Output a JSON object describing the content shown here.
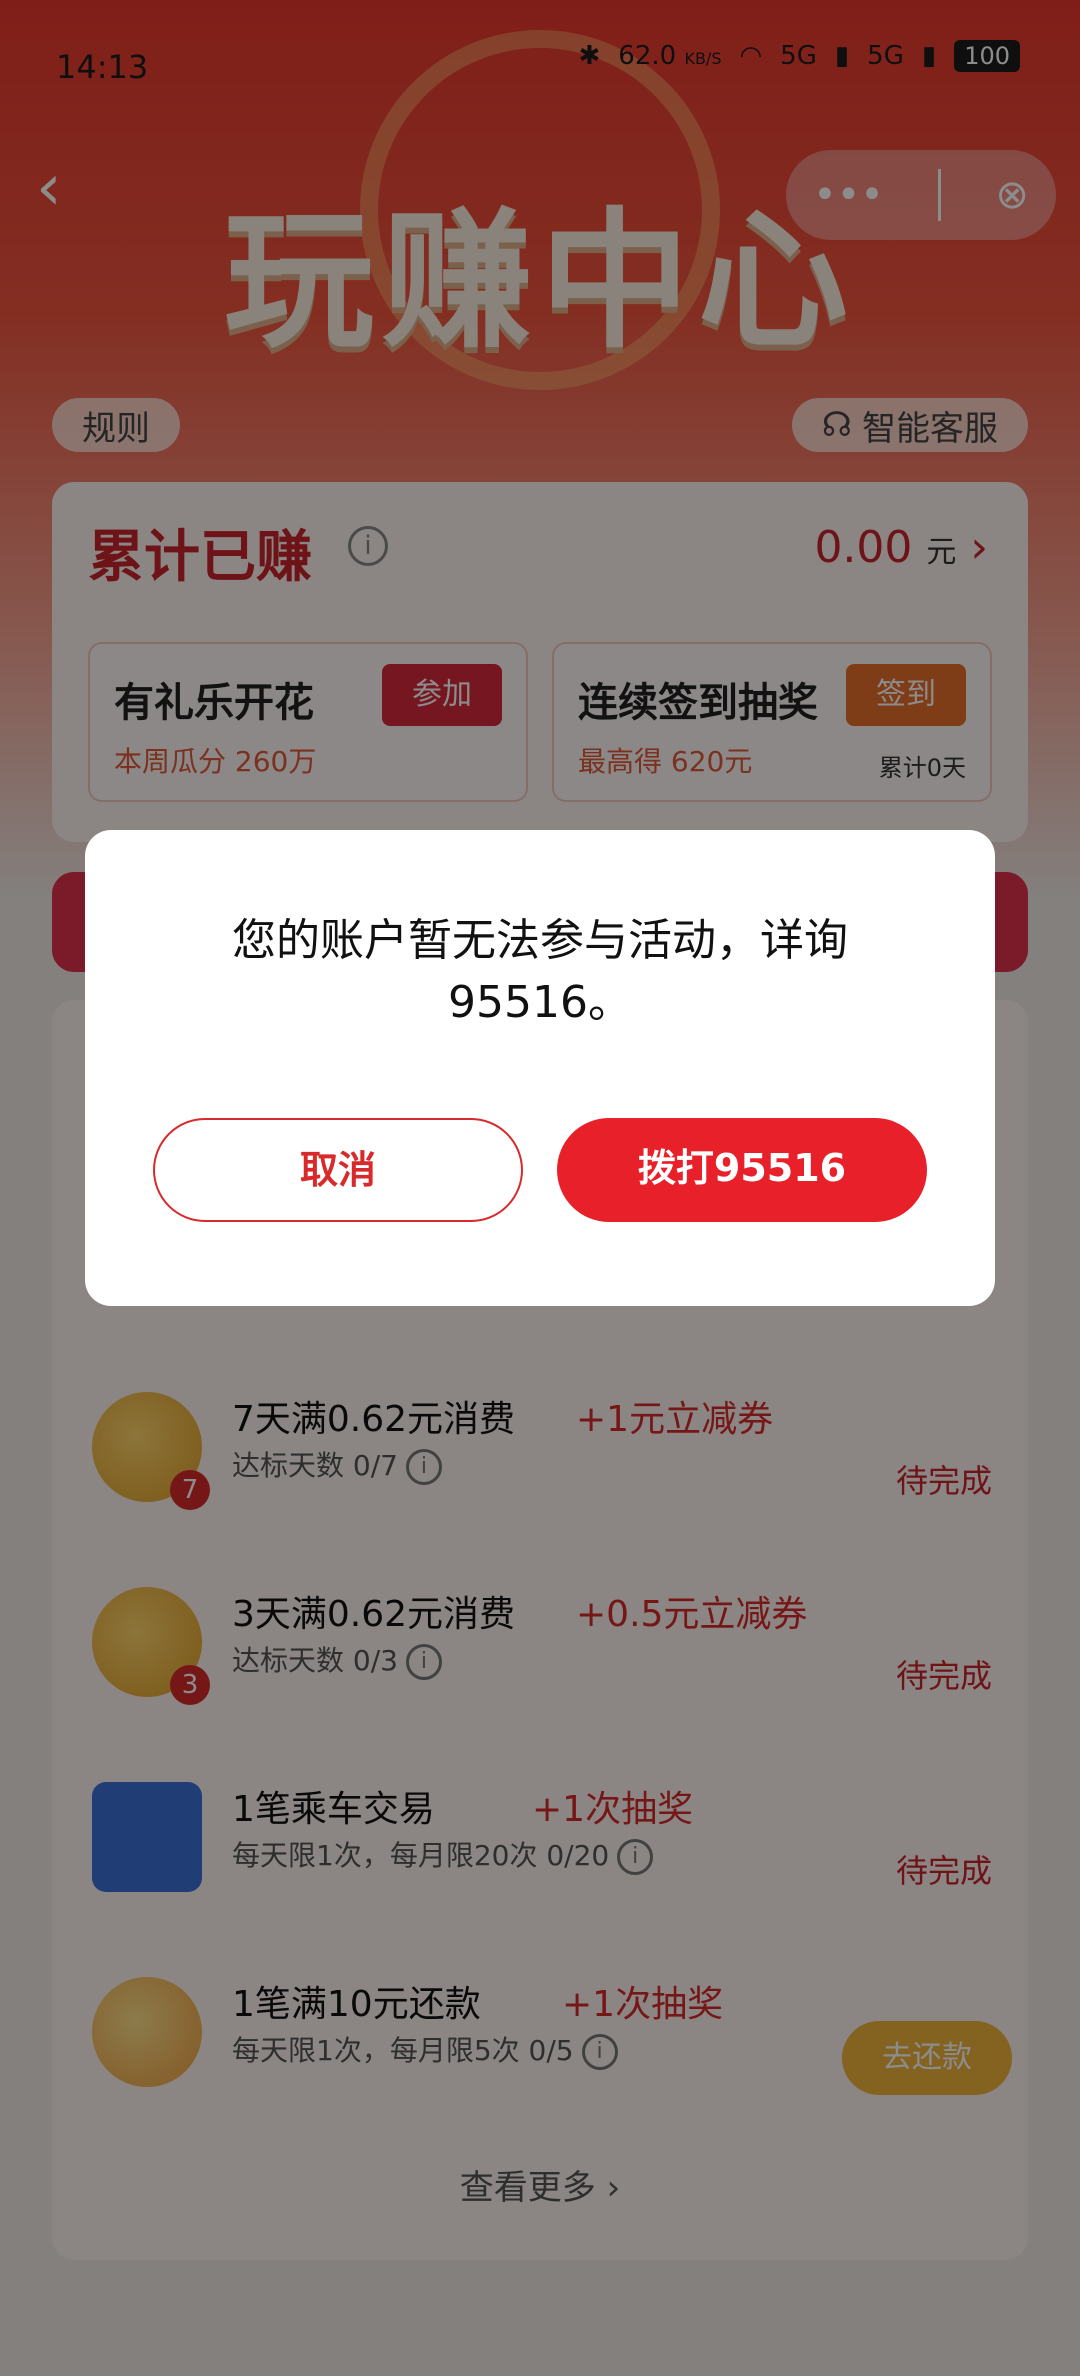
{
  "status_bar": {
    "time": "14:13",
    "speed": "62.0",
    "speed_unit": "KB/S",
    "net1": "5G",
    "net2": "5G",
    "battery": "100"
  },
  "header": {
    "title": "玩赚中心",
    "more_icon": "•••",
    "close_icon": "⊗",
    "back_icon": "‹"
  },
  "top_links": {
    "rules": "规则",
    "service": "智能客服"
  },
  "earnings": {
    "title": "累计已赚",
    "amount": "0.00",
    "unit": "元",
    "cards": [
      {
        "title": "有礼乐开花",
        "note_label": "本周瓜分",
        "note_value": "260万",
        "button": "参加",
        "btn_color": "#d8283b"
      },
      {
        "title": "连续签到抽奖",
        "note_label": "最高得",
        "note_value": "620元",
        "button": "签到",
        "extra": "累计0天",
        "btn_color": "#e8702a"
      }
    ]
  },
  "tasks": [
    {
      "title": "7天满0.62元消费",
      "reward": "+1元立减券",
      "sub": "达标天数 0/7",
      "badge": "7",
      "status": "待完成"
    },
    {
      "title": "3天满0.62元消费",
      "reward": "+0.5元立减券",
      "sub": "达标天数 0/3",
      "badge": "3",
      "status": "待完成"
    },
    {
      "title": "1笔乘车交易",
      "reward": "+1次抽奖",
      "sub": "每天限1次，每月限20次 0/20",
      "status": "待完成"
    },
    {
      "title": "1笔满10元还款",
      "reward": "+1次抽奖",
      "sub": "每天限1次，每月限5次 0/5",
      "action": "去还款"
    }
  ],
  "see_more": "查看更多",
  "dialog": {
    "message": "您的账户暂无法参与活动，详询95516。",
    "cancel": "取消",
    "call": "拨打95516"
  },
  "colors": {
    "accent": "#e8202a",
    "brand_red": "#c9262c"
  }
}
